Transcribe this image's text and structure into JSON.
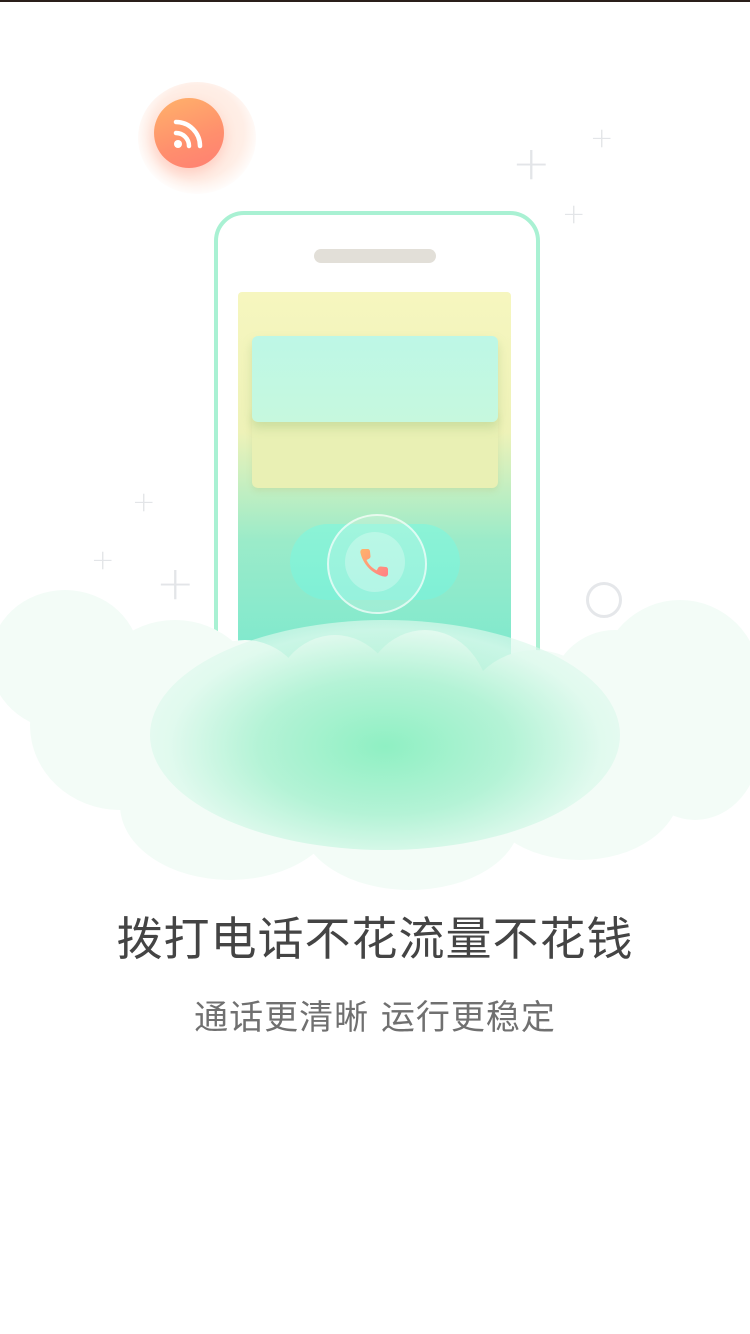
{
  "splash": {
    "headline": "拨打电话不花流量不花钱",
    "subline": "通话更清晰 运行更稳定"
  },
  "icons": {
    "wifi": "wifi-icon",
    "phone_call": "phone-call-icon"
  },
  "colors": {
    "accent_mint": "#a9f1d3",
    "wifi_orange": "#ff8f6d",
    "headline_text": "#444444",
    "subline_text": "#707070"
  }
}
